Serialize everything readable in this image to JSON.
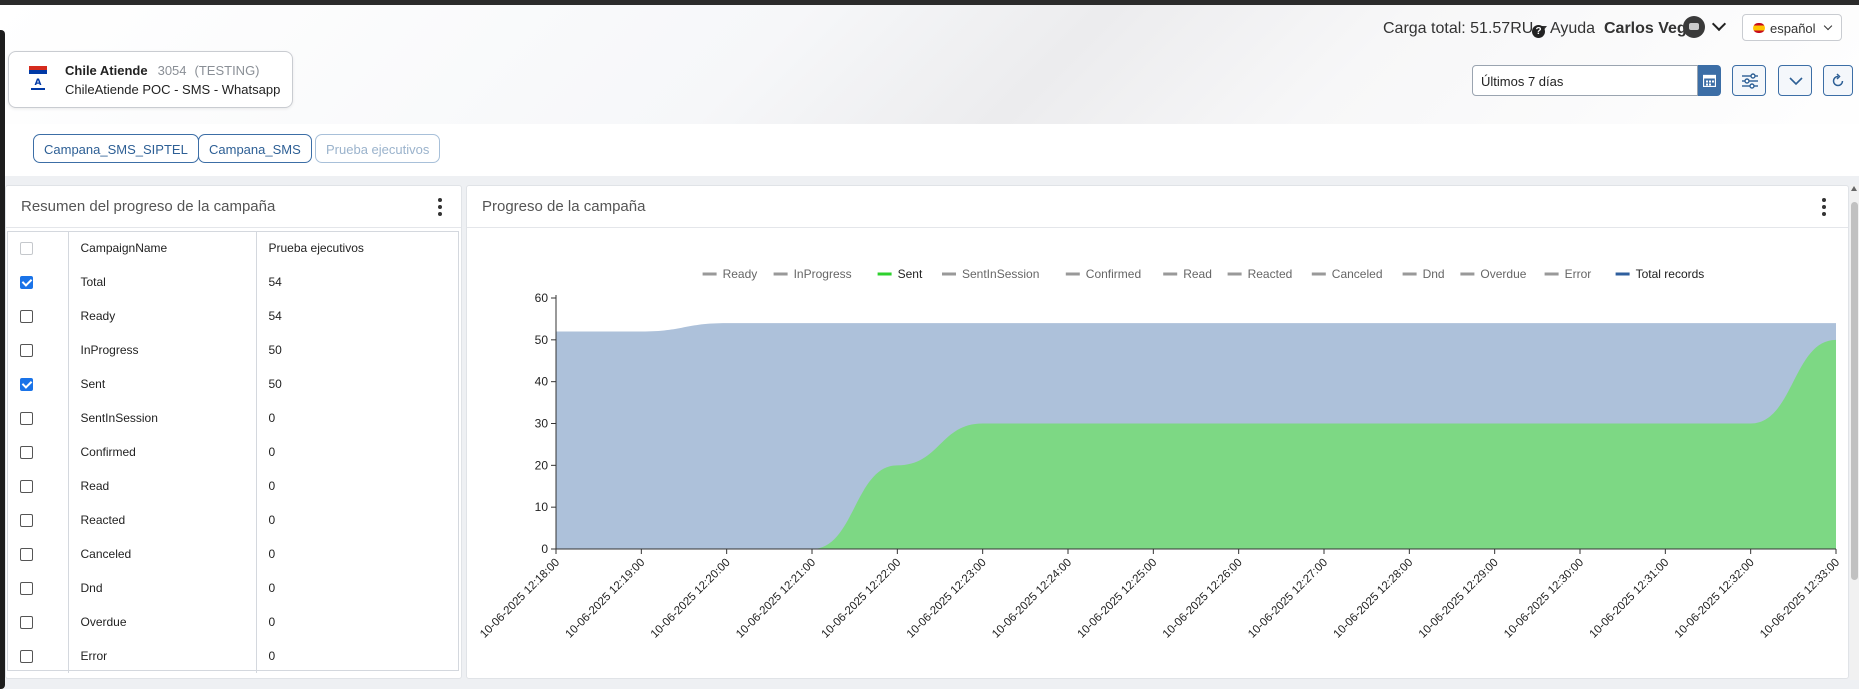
{
  "header": {
    "carga_label": "Carga total: 51.57RU",
    "ayuda_label": "Ayuda",
    "user_name": "Carlos Vega",
    "language": "español"
  },
  "account": {
    "name": "Chile Atiende",
    "id": "3054",
    "env": "(TESTING)",
    "subtitle": "ChileAtiende POC - SMS - Whatsapp"
  },
  "date_range": {
    "value": "Últimos 7 días"
  },
  "campaign_tabs": [
    {
      "label": "Campana_SMS_SIPTEL",
      "active": true
    },
    {
      "label": "Campana_SMS",
      "active": true
    },
    {
      "label": "Prueba ejecutivos",
      "active": false
    }
  ],
  "summary_panel": {
    "title": "Resumen del progreso de la campaña",
    "header": {
      "col1": "CampaignName",
      "col2": "Prueba ejecutivos"
    },
    "rows": [
      {
        "label": "Total",
        "value": "54",
        "checked": true
      },
      {
        "label": "Ready",
        "value": "54",
        "checked": false
      },
      {
        "label": "InProgress",
        "value": "50",
        "checked": false
      },
      {
        "label": "Sent",
        "value": "50",
        "checked": true
      },
      {
        "label": "SentInSession",
        "value": "0",
        "checked": false
      },
      {
        "label": "Confirmed",
        "value": "0",
        "checked": false
      },
      {
        "label": "Read",
        "value": "0",
        "checked": false
      },
      {
        "label": "Reacted",
        "value": "0",
        "checked": false
      },
      {
        "label": "Canceled",
        "value": "0",
        "checked": false
      },
      {
        "label": "Dnd",
        "value": "0",
        "checked": false
      },
      {
        "label": "Overdue",
        "value": "0",
        "checked": false
      },
      {
        "label": "Error",
        "value": "0",
        "checked": false
      }
    ]
  },
  "chart_panel": {
    "title": "Progreso de la campaña"
  },
  "chart_data": {
    "type": "area",
    "title": "",
    "xlabel": "",
    "ylabel": "",
    "ylim": [
      0,
      60
    ],
    "yticks": [
      0,
      10,
      20,
      30,
      40,
      50,
      60
    ],
    "grid": false,
    "legend_position": "top",
    "legend": [
      {
        "name": "Ready",
        "color": "#999999",
        "active": false
      },
      {
        "name": "InProgress",
        "color": "#999999",
        "active": false
      },
      {
        "name": "Sent",
        "color": "#2ed12e",
        "active": true
      },
      {
        "name": "SentInSession",
        "color": "#999999",
        "active": false
      },
      {
        "name": "Confirmed",
        "color": "#999999",
        "active": false
      },
      {
        "name": "Read",
        "color": "#999999",
        "active": false
      },
      {
        "name": "Reacted",
        "color": "#999999",
        "active": false
      },
      {
        "name": "Canceled",
        "color": "#999999",
        "active": false
      },
      {
        "name": "Dnd",
        "color": "#999999",
        "active": false
      },
      {
        "name": "Overdue",
        "color": "#999999",
        "active": false
      },
      {
        "name": "Error",
        "color": "#999999",
        "active": false
      },
      {
        "name": "Total records",
        "color": "#2f5f9e",
        "active": true
      }
    ],
    "x": [
      "10-06-2025 12:18:00",
      "10-06-2025 12:19:00",
      "10-06-2025 12:20:00",
      "10-06-2025 12:21:00",
      "10-06-2025 12:22:00",
      "10-06-2025 12:23:00",
      "10-06-2025 12:24:00",
      "10-06-2025 12:25:00",
      "10-06-2025 12:26:00",
      "10-06-2025 12:27:00",
      "10-06-2025 12:28:00",
      "10-06-2025 12:29:00",
      "10-06-2025 12:30:00",
      "10-06-2025 12:31:00",
      "10-06-2025 12:32:00",
      "10-06-2025 12:33:00"
    ],
    "series": [
      {
        "name": "Total records",
        "color": "#adc1da",
        "values": [
          52,
          52,
          54,
          54,
          54,
          54,
          54,
          54,
          54,
          54,
          54,
          54,
          54,
          54,
          54,
          54
        ]
      },
      {
        "name": "Sent",
        "color": "#7dd884",
        "values": [
          0,
          0,
          0,
          0,
          20,
          30,
          30,
          30,
          30,
          30,
          30,
          30,
          30,
          30,
          30,
          50
        ]
      }
    ]
  }
}
